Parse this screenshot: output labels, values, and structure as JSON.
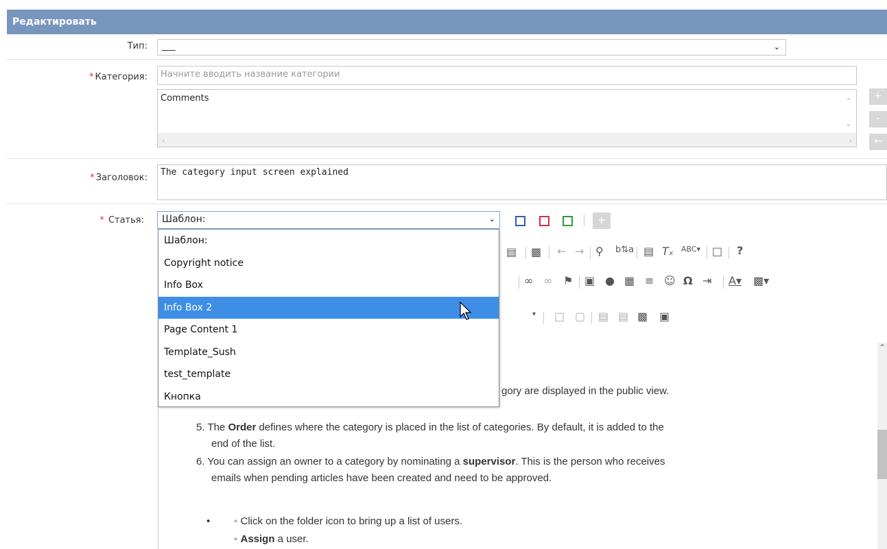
{
  "header": {
    "title": "Редактировать"
  },
  "type_row": {
    "label": "Тип:",
    "value": "___"
  },
  "category_row": {
    "label": "Категория:",
    "placeholder": "Начните вводить название категории",
    "list_items": [
      "Comments"
    ],
    "buttons": [
      "+",
      "-",
      "←"
    ]
  },
  "title_row": {
    "label": "Заголовок:",
    "value": "The category input screen explained"
  },
  "article_row": {
    "label": "Статья:",
    "template_value": "Шаблон:",
    "add_button": "+"
  },
  "template_dropdown": {
    "options": [
      "Шаблон:",
      "Copyright notice",
      "Info Box",
      "Info Box 2",
      "Page Content 1",
      "Template_Sush",
      "test_template",
      "Кнопка"
    ],
    "highlighted_index": 3
  },
  "editor": {
    "p1": "gory are displayed in the public view.",
    "item5_num": "5.",
    "item5_pre": "The ",
    "item5_bold": "Order",
    "item5_post": " defines where the category is placed in the list of categories. By default, it is added to the",
    "item5_line2": "end of the list.",
    "item6_num": "6.",
    "item6_pre": "You can assign an owner to a category by nominating a ",
    "item6_bold": "supervisor",
    "item6_post": ". This is the person who receives",
    "item6_line2": "emails when pending articles have been created and need to be approved.",
    "sub1": "Click on the folder icon to bring up a list of users.",
    "sub2_bold": "Assign",
    "sub2_post": " a user."
  },
  "toolbar": {
    "row1_icons": [
      "source-icon",
      "print-icon",
      "undo-icon",
      "redo-icon",
      "find-icon",
      "replace-icon",
      "paste-text-icon",
      "remove-format-icon",
      "spellcheck-icon",
      "maximize-icon",
      "help-icon"
    ],
    "row2_icons": [
      "link-icon",
      "unlink-icon",
      "anchor-icon",
      "image-icon",
      "flash-icon",
      "table-icon",
      "hr-icon",
      "smiley-icon",
      "special-char-icon",
      "pagebreak-icon",
      "text-color-icon",
      "bg-color-icon"
    ],
    "row3_icons": [
      "comment-icon",
      "delete-comment-icon",
      "form-icon",
      "template-icon",
      "video-icon",
      "external-icon"
    ],
    "help_glyph": "?",
    "omega_glyph": "Ω"
  }
}
